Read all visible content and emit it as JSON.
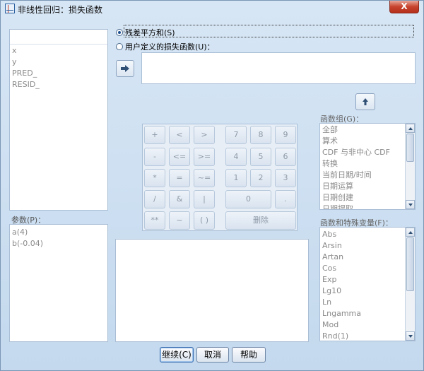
{
  "window": {
    "title": "非线性回归：损失函数",
    "close_label": "X"
  },
  "variables": [
    "x",
    "y",
    "PRED_",
    "RESID_"
  ],
  "parameters": {
    "label": "参数(P)：",
    "items": [
      "a(4)",
      "b(-0.04)"
    ]
  },
  "loss": {
    "option1": "残差平方和(S)",
    "option2": "用户定义的损失函数(U)：",
    "expression": ""
  },
  "keypad": {
    "keys": [
      "+",
      "<",
      ">",
      "7",
      "8",
      "9",
      "-",
      "<=",
      ">=",
      "4",
      "5",
      "6",
      "*",
      "=",
      "~=",
      "1",
      "2",
      "3",
      "/",
      "&",
      "|",
      "0",
      ".",
      "**",
      "~",
      "( )",
      "删除"
    ]
  },
  "function_group": {
    "label": "函数组(G)：",
    "items": [
      "全部",
      "算术",
      "CDF 与非中心 CDF",
      "转换",
      "当前日期/时间",
      "日期运算",
      "日期创建",
      "日期提取"
    ]
  },
  "functions": {
    "label": "函数和特殊变量(F)：",
    "items": [
      "Abs",
      "Arsin",
      "Artan",
      "Cos",
      "Exp",
      "Lg10",
      "Ln",
      "Lngamma",
      "Mod",
      "Rnd(1)"
    ]
  },
  "buttons": {
    "continue": "继续(C)",
    "cancel": "取消",
    "help": "帮助"
  }
}
